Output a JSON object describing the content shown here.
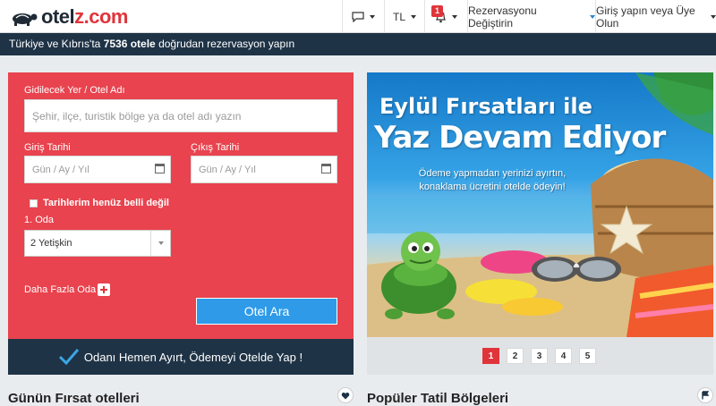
{
  "header": {
    "logo_text_a": "otel",
    "logo_text_b": "z.com",
    "currency": "TL",
    "notification_count": "1",
    "change_reservation": "Rezervasyonu Değiştirin",
    "login": "Giriş yapın veya Üye Olun"
  },
  "strip": {
    "pre": "Türkiye ve Kıbrıs'ta",
    "count": "7536 otele",
    "post": "doğrudan rezervasyon yapın"
  },
  "search": {
    "destination_label": "Gidilecek Yer / Otel Adı",
    "destination_placeholder": "Şehir, ilçe, turistik bölge ya da otel adı yazın",
    "checkin_label": "Giriş Tarihi",
    "checkin_placeholder": "Gün / Ay / Yıl",
    "checkout_label": "Çıkış Tarihi",
    "checkout_placeholder": "Gün / Ay / Yıl",
    "unknown_dates_label": "Tarihlerim henüz belli değil",
    "room_label": "1. Oda",
    "guests_value": "2 Yetişkin",
    "more_rooms_label": "Daha Fazla Oda",
    "submit_label": "Otel Ara",
    "footer_text": "Odanı Hemen Ayırt, Ödemeyi Otelde Yap !"
  },
  "promo": {
    "title_line1": "Eylül Fırsatları ile",
    "title_line2": "Yaz Devam Ediyor",
    "subtitle_line1": "Ödeme yapmadan yerinizi ayırtın,",
    "subtitle_line2": "konaklama ücretini otelde ödeyin!",
    "pages": [
      "1",
      "2",
      "3",
      "4",
      "5"
    ],
    "active_page": "1"
  },
  "sections": {
    "left_title": "Günün Fırsat otelleri",
    "right_title": "Popüler Tatil Bölgeleri"
  },
  "colors": {
    "brand_red": "#e8434e",
    "navy": "#1f3346",
    "button_blue": "#2f9be8"
  }
}
